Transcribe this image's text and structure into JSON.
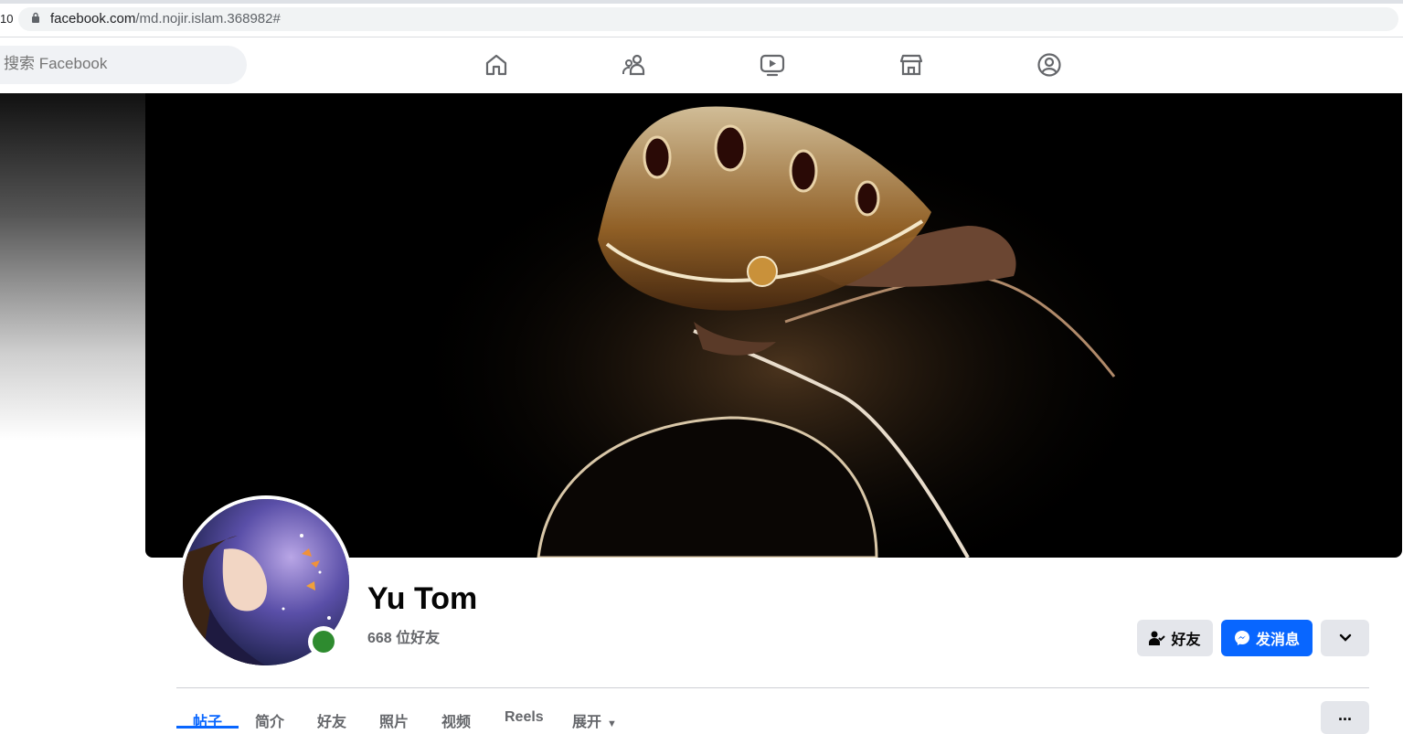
{
  "browser": {
    "tab_number": "10",
    "url_host": "facebook.com",
    "url_path": "/md.nojir.islam.368982#"
  },
  "nav": {
    "search_placeholder": "搜索 Facebook",
    "icons": [
      "home-icon",
      "friends-icon",
      "watch-icon",
      "marketplace-icon",
      "profile-circle-icon"
    ]
  },
  "profile": {
    "name": "Yu Tom",
    "friend_count": "668 位好友",
    "online": true
  },
  "actions": {
    "friends_label": "好友",
    "message_label": "发消息",
    "more_icon": "chevron-down-icon"
  },
  "tabs": [
    {
      "label": "帖子",
      "active": true
    },
    {
      "label": "简介"
    },
    {
      "label": "好友"
    },
    {
      "label": "照片"
    },
    {
      "label": "视频"
    },
    {
      "label": "Reels"
    },
    {
      "label": "展开"
    }
  ],
  "overflow_label": "...",
  "colors": {
    "accent": "#0866ff",
    "online": "#2e8b2f",
    "button_gray": "#e4e6eb"
  }
}
